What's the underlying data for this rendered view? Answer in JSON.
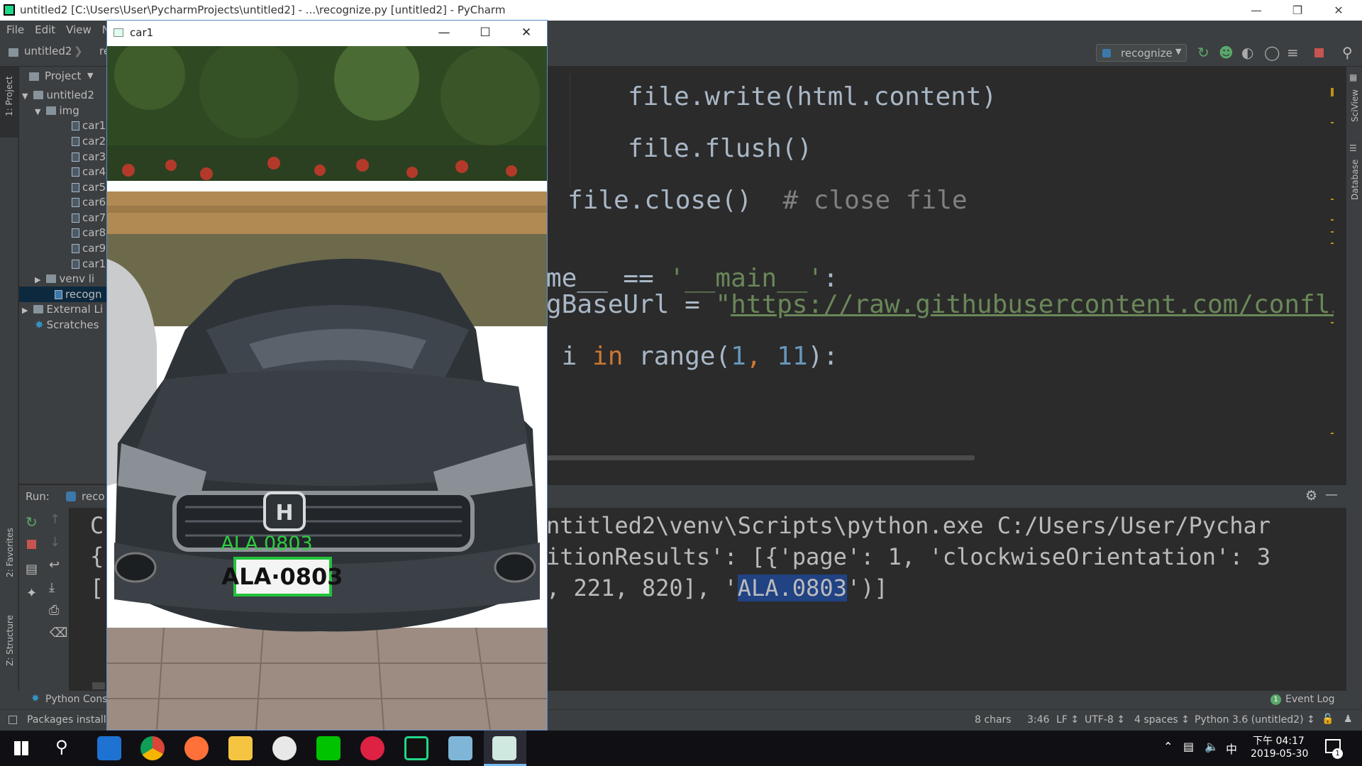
{
  "window": {
    "title": "untitled2 [C:\\Users\\User\\PycharmProjects\\untitled2] - ...\\recognize.py [untitled2] - PyCharm"
  },
  "menu": {
    "file": "File",
    "edit": "Edit",
    "view": "View",
    "nav": "N"
  },
  "navbar": {
    "project": "untitled2",
    "file": "re",
    "run_config": "recognize"
  },
  "project_panel": {
    "header": "Project",
    "root": "untitled2",
    "img_folder": "img",
    "files": [
      "car1",
      "car2",
      "car3",
      "car4",
      "car5",
      "car6",
      "car7",
      "car8",
      "car9",
      "car1"
    ],
    "venv": "venv li",
    "recognize": "recogn",
    "external": "External Li",
    "scratches": "Scratches"
  },
  "side_tabs": {
    "project": "1: Project",
    "favorites": "2: Favorites",
    "structure": "Z: Structure",
    "sciview": "SciView",
    "database": "Database"
  },
  "code": {
    "line1": "file.write(html.content)",
    "line2": "file.flush()",
    "line3_code": "file.close()",
    "line3_comment": "# close file",
    "line4_a": "me__ == ",
    "line4_str": "'__main__'",
    "line4_b": ":",
    "line5_a": "gBaseUrl = ",
    "line5_q": "\"",
    "line5_url": "https://raw.githubusercontent.com/conflick",
    "line6_a": " i ",
    "line6_kw": "in",
    "line6_b": " range(",
    "line6_n1": "1",
    "line6_c": ", ",
    "line6_n2": "11",
    "line6_d": "):"
  },
  "run": {
    "label": "Run:",
    "tab": "reco",
    "line1_left": "C",
    "line1": "ntitled2\\venv\\Scripts\\python.exe C:/Users/User/Pychar",
    "line2_left": "{",
    "line2": "itionResults': [{'page': 1, 'clockwiseOrientation': 3",
    "line3_left": "[",
    "line3_a": ", 221, 820], '",
    "line3_sel": "ALA.0803",
    "line3_b": "')]"
  },
  "bottom": {
    "python_console": "Python Cons",
    "event_log": "Event Log",
    "event_count": "1",
    "packages": "Packages install"
  },
  "status": {
    "chars": "8 chars",
    "pos": "3:46",
    "lf": "LF ↕",
    "enc": "UTF-8 ↕",
    "indent": "4 spaces ↕",
    "interp": "Python 3.6 (untitled2) ↕"
  },
  "image_window": {
    "title": "car1",
    "overlay_text": "ALA.0803",
    "plate_text": "ALA·0803"
  },
  "taskbar": {
    "time_label": "下午 04:17",
    "date": "2019-05-30",
    "ime": "中",
    "notif": "1"
  }
}
